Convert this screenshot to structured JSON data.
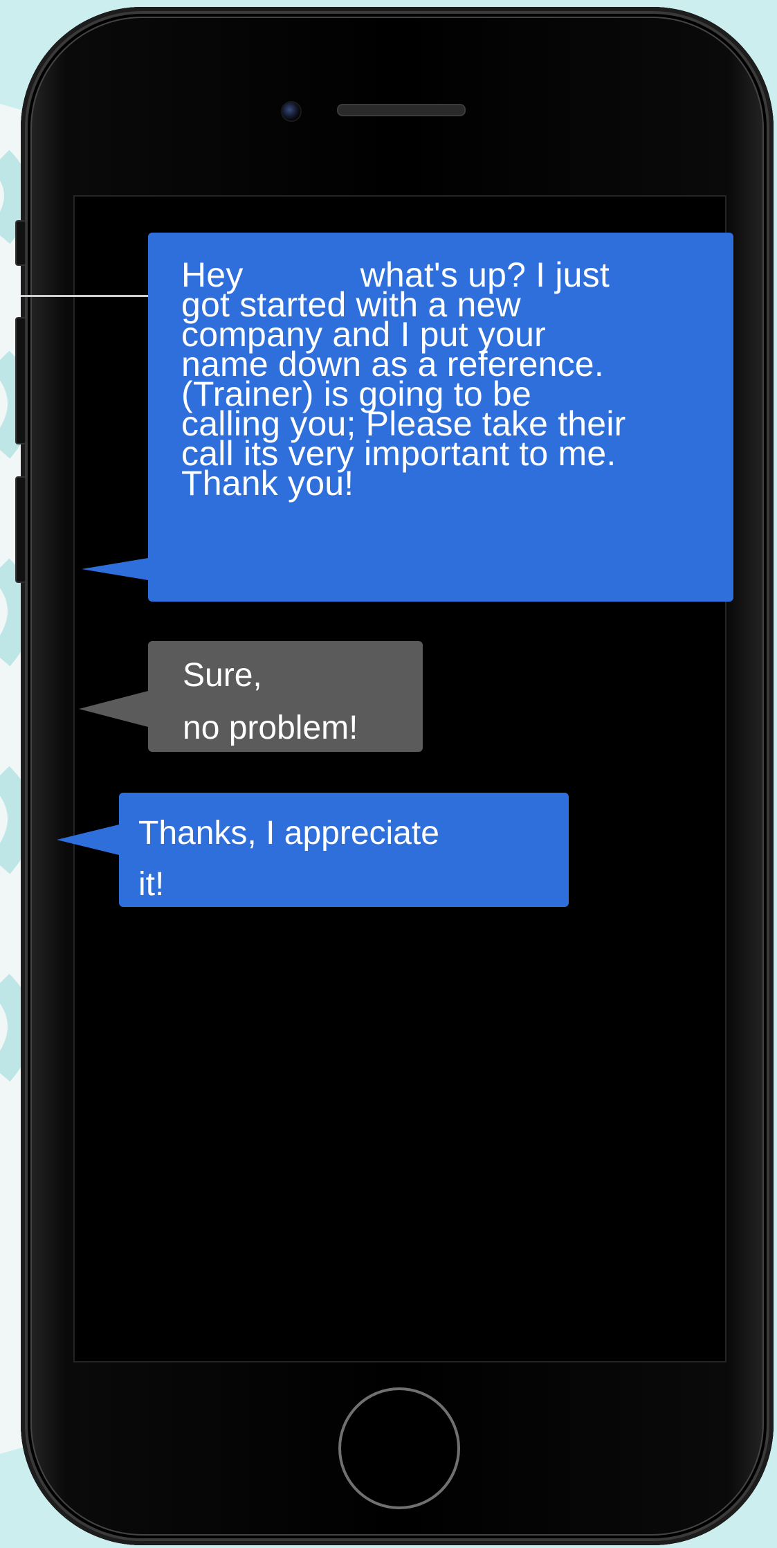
{
  "colors": {
    "background": "#cdeeee",
    "phone_body": "#000000",
    "sent_bubble": "#2f6fdb",
    "received_bubble": "#5b5b5b",
    "bubble_text": "#ffffff"
  },
  "icons": {
    "camera": "front-camera-icon",
    "speaker": "earpiece-speaker-icon",
    "home": "home-button-icon"
  },
  "messages": [
    {
      "sender": "self",
      "lines": [
        "Hey            what's up? I just",
        "got started with a new",
        "company and I put your",
        "name down as a reference.",
        "(Trainer) is going to be",
        "calling you; Please take their",
        "call its very important to me.",
        "Thank you!"
      ]
    },
    {
      "sender": "other",
      "lines": [
        "Sure,",
        "no problem!"
      ]
    },
    {
      "sender": "self",
      "lines": [
        "Thanks, I appreciate",
        "it!"
      ]
    }
  ]
}
